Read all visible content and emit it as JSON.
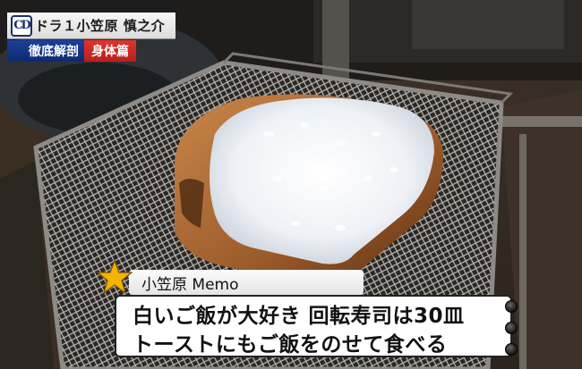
{
  "caption_top": {
    "logo": "CD",
    "title": "ドラ１小笠原 慎之介",
    "subtitle_left": "徹底解剖",
    "subtitle_right": "身体篇"
  },
  "memo": {
    "label": "小笠原 Memo",
    "line1": "白いご飯が大好き 回転寿司は30皿",
    "line2": "トーストにもご飯をのせて食べる"
  },
  "colors": {
    "caption_blue": "#0f2a73",
    "caption_red": "#c8241f",
    "logo_navy": "#1c2f6b",
    "star_yellow": "#f2b400"
  },
  "icons": [
    "team-logo-icon",
    "star-icon",
    "binder-ring-icon"
  ]
}
